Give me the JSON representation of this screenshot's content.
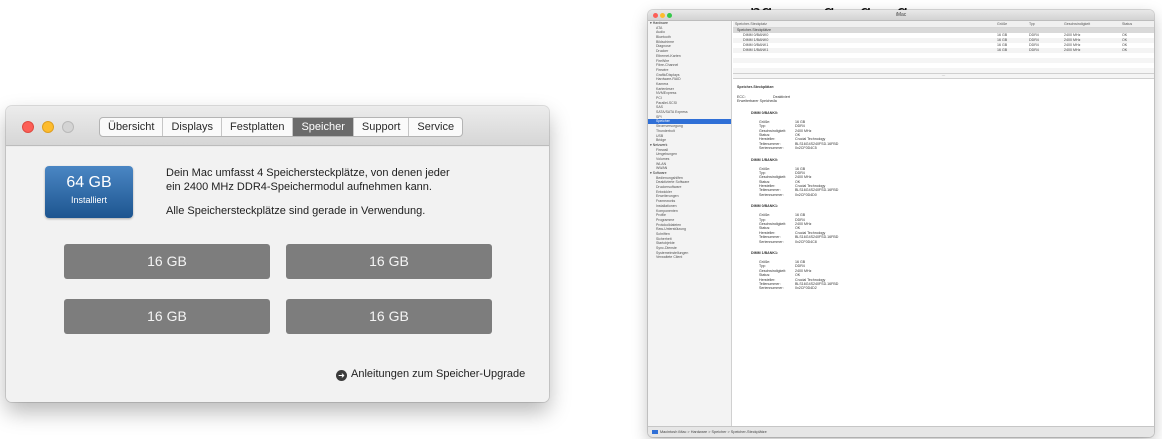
{
  "caption": "…ng … …g …g …g",
  "about_window": {
    "tabs": [
      {
        "label": "Übersicht",
        "active": false
      },
      {
        "label": "Displays",
        "active": false
      },
      {
        "label": "Festplatten",
        "active": false
      },
      {
        "label": "Speicher",
        "active": true
      },
      {
        "label": "Support",
        "active": false
      },
      {
        "label": "Service",
        "active": false
      }
    ],
    "memory_total": "64 GB",
    "memory_status": "Installiert",
    "description_line1": "Dein Mac umfasst 4 Speichersteckplätze, von denen jeder",
    "description_line2": "ein 2400 MHz DDR4-Speichermodul aufnehmen kann.",
    "slots_note": "Alle Speichersteckplätze sind gerade in Verwendung.",
    "slots": [
      "16 GB",
      "16 GB",
      "16 GB",
      "16 GB"
    ],
    "upgrade_link": "Anleitungen zum Speicher-Upgrade",
    "colors": {
      "accent": "#2a6aa8",
      "slot": "#7d7d7d",
      "tab_active": "#6b6b6b"
    }
  },
  "sysinfo_window": {
    "title": "iMac",
    "sidebar": [
      {
        "label": "Hardware",
        "cat": true
      },
      {
        "label": "ATA"
      },
      {
        "label": "Audio"
      },
      {
        "label": "Bluetooth"
      },
      {
        "label": "Bildschirme"
      },
      {
        "label": "Diagnose"
      },
      {
        "label": "Drucker"
      },
      {
        "label": "Ethernet-Karten"
      },
      {
        "label": "FireWire"
      },
      {
        "label": "Fibre-Channel"
      },
      {
        "label": "Firewire"
      },
      {
        "label": "Grafik/Displays"
      },
      {
        "label": "Hardware-RAID"
      },
      {
        "label": "Kamera"
      },
      {
        "label": "Kartenleser"
      },
      {
        "label": "NVMExpress"
      },
      {
        "label": "PCI"
      },
      {
        "label": "Parallel-SCSI"
      },
      {
        "label": "SAS"
      },
      {
        "label": "SATA/SATA Express"
      },
      {
        "label": "SPI"
      },
      {
        "label": "Speicher",
        "sel": true
      },
      {
        "label": "Stromversorgung"
      },
      {
        "label": "Thunderbolt"
      },
      {
        "label": "USB"
      },
      {
        "label": "Bridge"
      },
      {
        "label": "Netzwerk",
        "cat": true
      },
      {
        "label": "Firewall"
      },
      {
        "label": "Umgebungen"
      },
      {
        "label": "Volumes"
      },
      {
        "label": "WLAN"
      },
      {
        "label": "WWAN"
      },
      {
        "label": "Software",
        "cat": true
      },
      {
        "label": "Bedienungshilfen"
      },
      {
        "label": "Deaktivierte Software"
      },
      {
        "label": "Druckersoftware"
      },
      {
        "label": "Entwickler"
      },
      {
        "label": "Erweiterungen"
      },
      {
        "label": "Frameworks"
      },
      {
        "label": "Installationen"
      },
      {
        "label": "Komponenten"
      },
      {
        "label": "Profile"
      },
      {
        "label": "Programme"
      },
      {
        "label": "Protokolldateien"
      },
      {
        "label": "Raw-Unterstützung"
      },
      {
        "label": "Schriften"
      },
      {
        "label": "Sicherheit"
      },
      {
        "label": "Startobjekte"
      },
      {
        "label": "Sync-Dienste"
      },
      {
        "label": "Systemeinstellungen"
      },
      {
        "label": "Verwaltete Client"
      }
    ],
    "table_headers": [
      "Speicher-Steckplatz",
      "Größe",
      "Typ",
      "Geschwindigkeit",
      "Status"
    ],
    "group_label": "Speicher-Steckplätze",
    "rows": [
      {
        "slot": "DIMM 0/BANK0",
        "size": "16 GB",
        "type": "DDR4",
        "speed": "2400 MHz",
        "status": "OK"
      },
      {
        "slot": "DIMM 1/BANK0",
        "size": "16 GB",
        "type": "DDR4",
        "speed": "2400 MHz",
        "status": "OK"
      },
      {
        "slot": "DIMM 0/BANK1",
        "size": "16 GB",
        "type": "DDR4",
        "speed": "2400 MHz",
        "status": "OK"
      },
      {
        "slot": "DIMM 1/BANK1",
        "size": "16 GB",
        "type": "DDR4",
        "speed": "2400 MHz",
        "status": "OK"
      }
    ],
    "detail": {
      "heading": "Speicher-Steckplätze:",
      "ecc_key": "ECC:",
      "ecc_value": "Deaktiviert",
      "upgrade_key": "Erweiterbarer Speicher:",
      "upgrade_value": "Ja",
      "banks": [
        {
          "name": "DIMM 0/BANK0:",
          "size": "16 GB",
          "type": "DDR4",
          "speed": "2400 MHz",
          "status": "OK",
          "maker": "Crucial Technology",
          "part": "BLS16G4S240FSD.16FBD",
          "serial": "0x2CF0D4C5"
        },
        {
          "name": "DIMM 1/BANK0:",
          "size": "16 GB",
          "type": "DDR4",
          "speed": "2400 MHz",
          "status": "OK",
          "maker": "Crucial Technology",
          "part": "BLS16G4S240FSD.16FBD",
          "serial": "0x2CF0D4D0"
        },
        {
          "name": "DIMM 0/BANK1:",
          "size": "16 GB",
          "type": "DDR4",
          "speed": "2400 MHz",
          "status": "OK",
          "maker": "Crucial Technology",
          "part": "BLS16G4S240FSD.16FBD",
          "serial": "0x2CF0D4C8"
        },
        {
          "name": "DIMM 1/BANK1:",
          "size": "16 GB",
          "type": "DDR4",
          "speed": "2400 MHz",
          "status": "OK",
          "maker": "Crucial Technology",
          "part": "BLS16G4S240FSD.16FBD",
          "serial": "0x2CF0D4D2"
        }
      ],
      "labels": {
        "size": "Größe:",
        "type": "Typ:",
        "speed": "Geschwindigkeit:",
        "status": "Status:",
        "maker": "Hersteller:",
        "part": "Teilenummer:",
        "serial": "Seriennummer:"
      }
    },
    "statusbar": "Macintosh iMac > Hardware > Speicher > Speicher-Steckplätze"
  }
}
